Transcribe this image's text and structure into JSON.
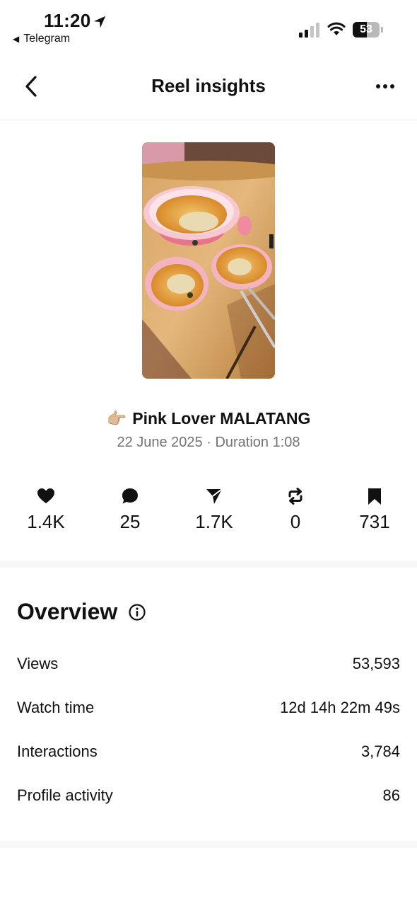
{
  "status_bar": {
    "time": "11:20",
    "back_app": "Telegram",
    "battery_level": "53",
    "battery_percent": 53
  },
  "nav": {
    "title": "Reel insights"
  },
  "reel": {
    "emoji": "👉🏼",
    "title": "Pink Lover MALATANG",
    "meta": "22 June 2025 · Duration 1:08"
  },
  "stats": {
    "likes": "1.4K",
    "comments": "25",
    "shares": "1.7K",
    "reposts": "0",
    "saves": "731"
  },
  "overview": {
    "title": "Overview",
    "rows": [
      {
        "label": "Views",
        "value": "53,593"
      },
      {
        "label": "Watch time",
        "value": "12d 14h 22m 49s"
      },
      {
        "label": "Interactions",
        "value": "3,784"
      },
      {
        "label": "Profile activity",
        "value": "86"
      }
    ]
  },
  "colors": {
    "text": "#111111",
    "muted": "#737373",
    "divider": "#f7f7f7"
  }
}
